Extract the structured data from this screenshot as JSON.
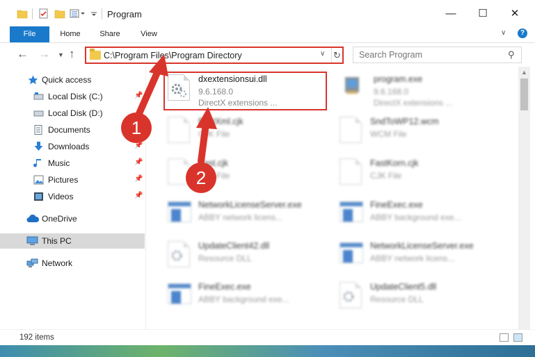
{
  "window": {
    "title": "Program",
    "minimize_glyph": "—",
    "maximize_glyph": "☐",
    "close_glyph": "✕"
  },
  "ribbon": {
    "tabs": [
      {
        "label": "File"
      },
      {
        "label": "Home"
      },
      {
        "label": "Share"
      },
      {
        "label": "View"
      }
    ],
    "help_glyph": "?"
  },
  "nav": {
    "address": "C:\\Program Files\\Program Directory",
    "search_placeholder": "Search Program"
  },
  "sidebar": {
    "items": [
      {
        "label": "Quick access",
        "icon": "star-icon",
        "pinned": false
      },
      {
        "label": "Local Disk (C:)",
        "icon": "drive-icon",
        "pinned": true
      },
      {
        "label": "Local Disk (D:)",
        "icon": "drive-icon",
        "pinned": false
      },
      {
        "label": "Documents",
        "icon": "documents-icon",
        "pinned": true
      },
      {
        "label": "Downloads",
        "icon": "download-icon",
        "pinned": true
      },
      {
        "label": "Music",
        "icon": "music-icon",
        "pinned": true
      },
      {
        "label": "Pictures",
        "icon": "pictures-icon",
        "pinned": true
      },
      {
        "label": "Videos",
        "icon": "videos-icon",
        "pinned": true
      },
      {
        "label": "OneDrive",
        "icon": "cloud-icon",
        "pinned": false
      },
      {
        "label": "This PC",
        "icon": "computer-icon",
        "pinned": false,
        "selected": true
      },
      {
        "label": "Network",
        "icon": "network-icon",
        "pinned": false
      }
    ]
  },
  "files": [
    {
      "name": "dxextensionsui.dll",
      "line1": "9.6.168.0",
      "line2": "DirectX extensions ...",
      "icon": "dll-gear-icon"
    },
    {
      "name": "program.exe",
      "line1": "9.6.168.0",
      "line2": "DirectX extensions ...",
      "icon": "exe-icon"
    },
    {
      "name": "FastXml.cjk",
      "line1": "CJK File",
      "line2": "",
      "icon": "blank-file-icon"
    },
    {
      "name": "SndToWP12.wcm",
      "line1": "WCM File",
      "line2": "",
      "icon": "blank-file-icon"
    },
    {
      "name": "Fast.cjk",
      "line1": "CJK File",
      "line2": "",
      "icon": "blank-file-icon"
    },
    {
      "name": "FastKorn.cjk",
      "line1": "CJK File",
      "line2": "",
      "icon": "blank-file-icon"
    },
    {
      "name": "NetworkLicenseServer.exe",
      "line1": "ABBY network licens...",
      "line2": "",
      "icon": "app-window-icon"
    },
    {
      "name": "FineExec.exe",
      "line1": "ABBY background exe...",
      "line2": "",
      "icon": "app-window-icon"
    },
    {
      "name": "UpdateClient42.dll",
      "line1": "Resource DLL",
      "line2": "",
      "icon": "dll-gear-icon"
    },
    {
      "name": "NetworkLicenseServer.exe",
      "line1": "ABBY network licens...",
      "line2": "",
      "icon": "app-window-icon"
    },
    {
      "name": "FineExec.exe",
      "line1": "ABBY background exe...",
      "line2": "",
      "icon": "app-window-icon"
    },
    {
      "name": "UpdateClient5.dll",
      "line1": "Resource DLL",
      "line2": "",
      "icon": "dll-gear-icon"
    }
  ],
  "status": {
    "item_count": "192 items"
  },
  "callouts": [
    "1",
    "2"
  ],
  "colors": {
    "accent": "#1979ca",
    "highlight": "#d9342b"
  }
}
